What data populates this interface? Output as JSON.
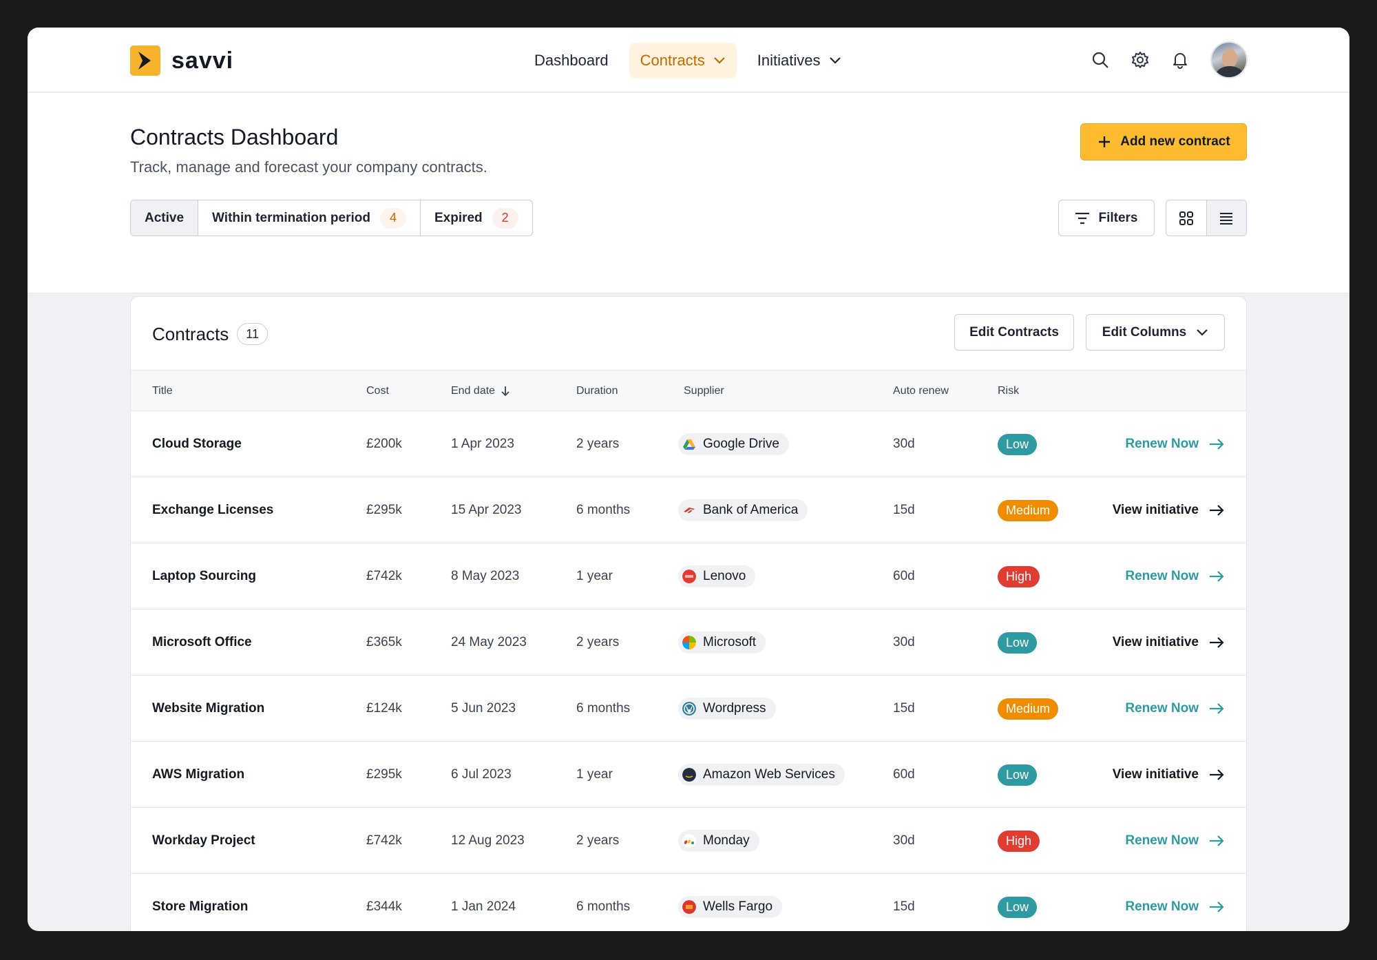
{
  "brand": {
    "name": "savvi",
    "accent": "#f7b32b"
  },
  "nav": {
    "links": [
      {
        "label": "Dashboard",
        "active": false,
        "dropdown": false
      },
      {
        "label": "Contracts",
        "active": true,
        "dropdown": true
      },
      {
        "label": "Initiatives",
        "active": false,
        "dropdown": true
      }
    ],
    "icons": [
      "search-icon",
      "gear-icon",
      "bell-icon"
    ]
  },
  "header": {
    "title": "Contracts Dashboard",
    "subtitle": "Track, manage and forecast your company contracts.",
    "add_button": "Add new contract",
    "tabs": [
      {
        "label": "Active",
        "count": ""
      },
      {
        "label": "Within termination period",
        "count": "4"
      },
      {
        "label": "Expired",
        "count": "2"
      }
    ],
    "filters_label": "Filters"
  },
  "card": {
    "title": "Contracts",
    "count": "11",
    "edit_contracts": "Edit Contracts",
    "edit_columns": "Edit Columns"
  },
  "table": {
    "headers": {
      "title": "Title",
      "cost": "Cost",
      "end": "End date",
      "duration": "Duration",
      "supplier": "Supplier",
      "auto": "Auto renew",
      "risk": "Risk"
    },
    "rows": [
      {
        "title": "Cloud Storage",
        "cost": "£200k",
        "end": "1 Apr 2023",
        "duration": "2 years",
        "supplier": "Google Drive",
        "auto": "30d",
        "risk": "Low",
        "action": "Renew Now"
      },
      {
        "title": "Exchange Licenses",
        "cost": "£295k",
        "end": "15 Apr 2023",
        "duration": "6 months",
        "supplier": "Bank of America",
        "auto": "15d",
        "risk": "Medium",
        "action": "View initiative"
      },
      {
        "title": "Laptop Sourcing",
        "cost": "£742k",
        "end": "8 May 2023",
        "duration": "1 year",
        "supplier": "Lenovo",
        "auto": "60d",
        "risk": "High",
        "action": "Renew Now"
      },
      {
        "title": "Microsoft Office",
        "cost": "£365k",
        "end": "24 May 2023",
        "duration": "2 years",
        "supplier": "Microsoft",
        "auto": "30d",
        "risk": "Low",
        "action": "View initiative"
      },
      {
        "title": "Website Migration",
        "cost": "£124k",
        "end": "5 Jun 2023",
        "duration": "6 months",
        "supplier": "Wordpress",
        "auto": "15d",
        "risk": "Medium",
        "action": "Renew Now"
      },
      {
        "title": "AWS Migration",
        "cost": "£295k",
        "end": "6 Jul 2023",
        "duration": "1 year",
        "supplier": "Amazon Web Services",
        "auto": "60d",
        "risk": "Low",
        "action": "View initiative"
      },
      {
        "title": "Workday Project",
        "cost": "£742k",
        "end": "12 Aug 2023",
        "duration": "2 years",
        "supplier": "Monday",
        "auto": "30d",
        "risk": "High",
        "action": "Renew Now"
      },
      {
        "title": "Store Migration",
        "cost": "£344k",
        "end": "1 Jan 2024",
        "duration": "6 months",
        "supplier": "Wells Fargo",
        "auto": "15d",
        "risk": "Low",
        "action": "Renew Now"
      }
    ]
  },
  "colors": {
    "low": "#2e9aa2",
    "medium": "#f08c00",
    "high": "#e03c31",
    "renew": "#2e9aa2"
  }
}
